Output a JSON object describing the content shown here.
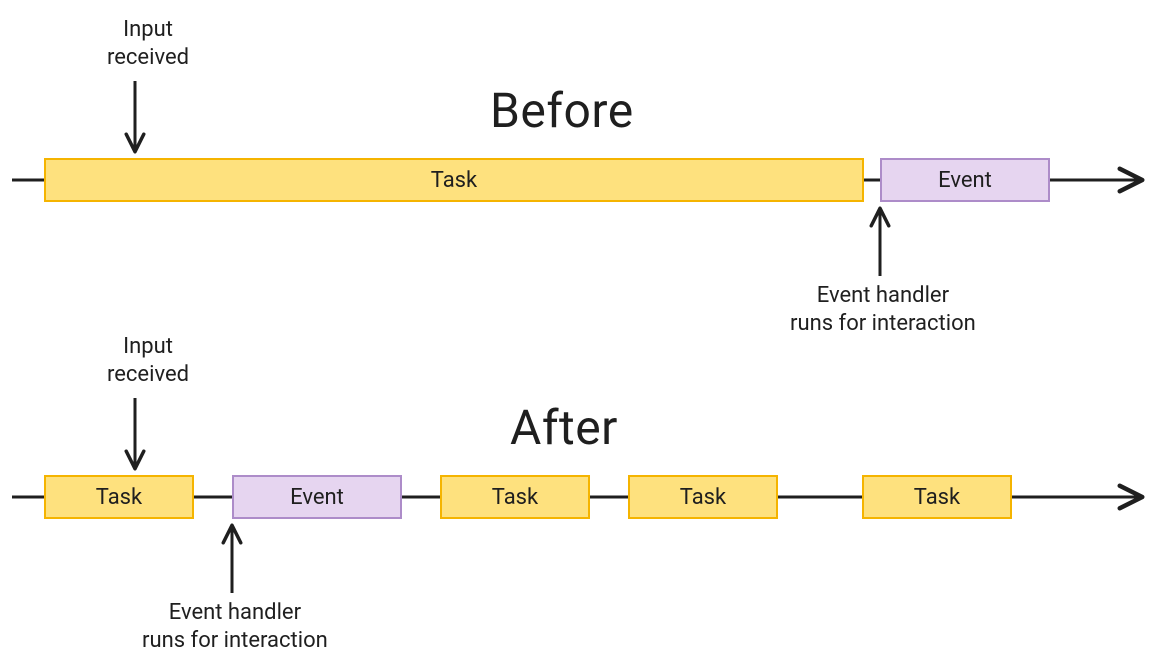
{
  "headings": {
    "before": "Before",
    "after": "After"
  },
  "labels": {
    "input_received_before_l1": "Input",
    "input_received_before_l2": "received",
    "input_received_after_l1": "Input",
    "input_received_after_l2": "received",
    "event_handler_before_l1": "Event handler",
    "event_handler_before_l2": "runs for interaction",
    "event_handler_after_l1": "Event handler",
    "event_handler_after_l2": "runs for interaction"
  },
  "blocks": {
    "before_task": "Task",
    "before_event": "Event",
    "after_task1": "Task",
    "after_event": "Event",
    "after_task2": "Task",
    "after_task3": "Task",
    "after_task4": "Task"
  },
  "chart_data": {
    "type": "diagram",
    "title": "Task scheduling before vs after yielding",
    "timelines": [
      {
        "name": "Before",
        "annotations": [
          {
            "kind": "input_received",
            "at_block_index": 0,
            "position": "early"
          },
          {
            "kind": "event_handler_runs",
            "at_block_index": 1
          }
        ],
        "blocks": [
          {
            "label": "Task",
            "type": "task",
            "relative_width": 820
          },
          {
            "label": "Event",
            "type": "event",
            "relative_width": 170
          }
        ]
      },
      {
        "name": "After",
        "annotations": [
          {
            "kind": "input_received",
            "at_block_index": 0,
            "position": "late"
          },
          {
            "kind": "event_handler_runs",
            "at_block_index": 1
          }
        ],
        "blocks": [
          {
            "label": "Task",
            "type": "task",
            "relative_width": 150
          },
          {
            "label": "Event",
            "type": "event",
            "relative_width": 170
          },
          {
            "label": "Task",
            "type": "task",
            "relative_width": 150
          },
          {
            "label": "Task",
            "type": "task",
            "relative_width": 150
          },
          {
            "label": "Task",
            "type": "task",
            "relative_width": 150
          }
        ]
      }
    ]
  }
}
